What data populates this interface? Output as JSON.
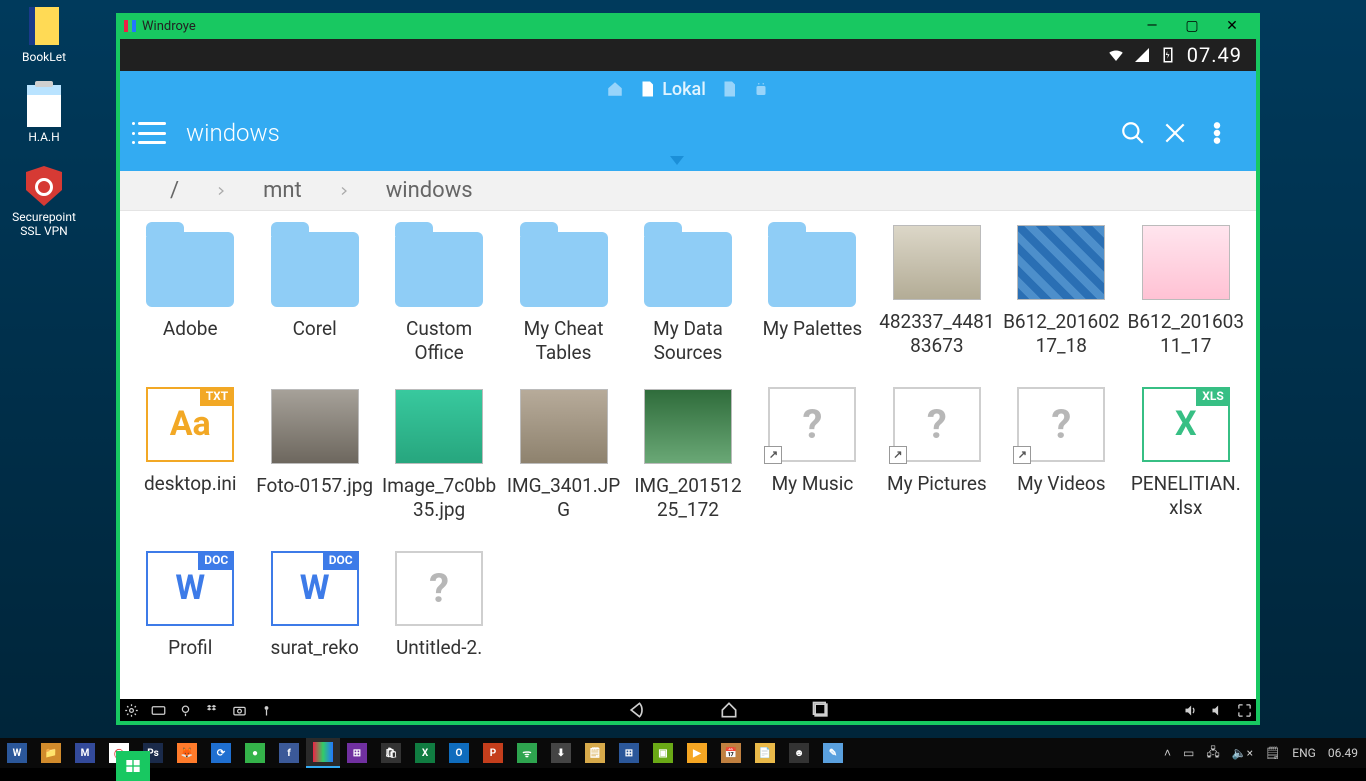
{
  "desktop": {
    "icons": [
      {
        "label": "BookLet"
      },
      {
        "label": "H.A.H"
      },
      {
        "label": "Securepoint SSL VPN"
      }
    ]
  },
  "window": {
    "title": "Windroye",
    "minimize": "—",
    "maximize": "▢",
    "close": "✕"
  },
  "statusbar": {
    "time": "07.49"
  },
  "topbar": {
    "tab_local": "Lokal"
  },
  "toolbar": {
    "title": "windows"
  },
  "breadcrumb": {
    "root": "/",
    "seg1": "mnt",
    "seg2": "windows"
  },
  "files": {
    "f0": {
      "label": "Adobe",
      "kind": "folder"
    },
    "f1": {
      "label": "Corel",
      "kind": "folder"
    },
    "f2": {
      "label": "Custom Office",
      "kind": "folder"
    },
    "f3": {
      "label": "My Cheat Tables",
      "kind": "folder"
    },
    "f4": {
      "label": "My Data Sources",
      "kind": "folder"
    },
    "f5": {
      "label": "My Palettes",
      "kind": "folder"
    },
    "f6": {
      "label": "482337_448183673",
      "kind": "photo"
    },
    "f7": {
      "label": "B612_20160217_18",
      "kind": "photo"
    },
    "f8": {
      "label": "B612_20160311_17",
      "kind": "photo"
    },
    "f9": {
      "label": "desktop.ini",
      "kind": "txt",
      "glyph": "Aa",
      "tag": "TXT"
    },
    "f10": {
      "label": "Foto-0157.jpg",
      "kind": "photo"
    },
    "f11": {
      "label": "Image_7c0bb35.jpg",
      "kind": "photo"
    },
    "f12": {
      "label": "IMG_3401.JPG",
      "kind": "photo"
    },
    "f13": {
      "label": "IMG_20151225_172",
      "kind": "photo"
    },
    "f14": {
      "label": "My Music",
      "kind": "unknown",
      "glyph": "?"
    },
    "f15": {
      "label": "My Pictures",
      "kind": "unknown",
      "glyph": "?"
    },
    "f16": {
      "label": "My Videos",
      "kind": "unknown",
      "glyph": "?"
    },
    "f17": {
      "label": "PENELITIAN.xlsx",
      "kind": "xls",
      "glyph": "X",
      "tag": "XLS"
    },
    "f18": {
      "label": "Profil",
      "kind": "word",
      "glyph": "W",
      "tag": "DOC"
    },
    "f19": {
      "label": "surat_reko",
      "kind": "word",
      "glyph": "W",
      "tag": "DOC"
    },
    "f20": {
      "label": "Untitled-2.",
      "kind": "unknown",
      "glyph": "?"
    }
  },
  "taskbar": {
    "lang": "ENG",
    "clock": "06.49"
  }
}
